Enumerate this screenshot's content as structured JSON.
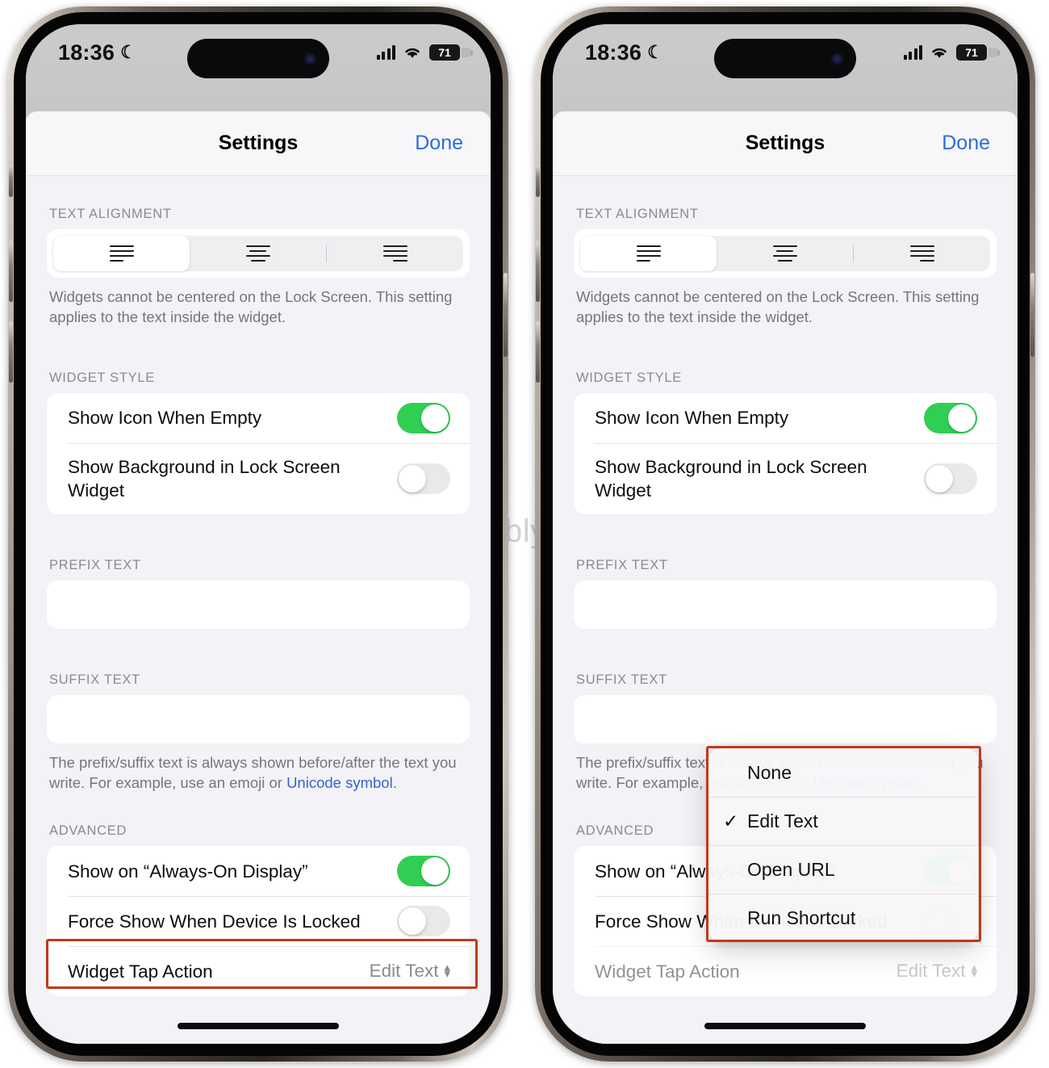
{
  "statusbar": {
    "time": "18:36",
    "dnd_icon": "☾",
    "battery_percent": "71",
    "signal_icon": "cellular-bars-icon",
    "wifi_icon": "wifi-icon"
  },
  "navbar": {
    "title": "Settings",
    "done_label": "Done"
  },
  "sections": {
    "text_alignment": {
      "header": "TEXT ALIGNMENT",
      "options": [
        "align-left",
        "align-center",
        "align-right"
      ],
      "selected_index": 0,
      "footer": "Widgets cannot be centered on the Lock Screen. This setting applies to the text inside the widget."
    },
    "widget_style": {
      "header": "WIDGET STYLE",
      "rows": [
        {
          "label": "Show Icon When Empty",
          "toggle": "on"
        },
        {
          "label": "Show Background in Lock Screen Widget",
          "toggle": "off"
        }
      ]
    },
    "prefix_text": {
      "header": "PREFIX TEXT",
      "value": "",
      "placeholder": ""
    },
    "suffix_text": {
      "header": "SUFFIX TEXT",
      "value": "",
      "placeholder": ""
    },
    "prefix_suffix_footer": {
      "text_before": "The prefix/suffix text is always shown before/after the text you write. For example, use an emoji or ",
      "link_text": "Unicode symbol",
      "text_after": "."
    },
    "advanced": {
      "header": "ADVANCED",
      "rows": [
        {
          "label": "Show on “Always-On Display”",
          "toggle": "on"
        },
        {
          "label": "Force Show When Device Is Locked",
          "toggle": "off"
        },
        {
          "label": "Widget Tap Action",
          "value": "Edit Text",
          "chevron": "chevron-up-down-icon"
        }
      ]
    }
  },
  "menu": {
    "items": [
      {
        "label": "None",
        "checked": false
      },
      {
        "label": "Edit Text",
        "checked": true
      },
      {
        "label": "Open URL",
        "checked": false
      },
      {
        "label": "Run Shortcut",
        "checked": false
      }
    ],
    "check_glyph": "✓"
  },
  "watermark": "Yablyk",
  "colors": {
    "accent_blue": "#2d6cdf",
    "toggle_on_green": "#30cf53",
    "toggle_off_gray": "#e9e9eb",
    "highlight_red": "#c0391b",
    "link_blue": "#3a62c9",
    "page_background": "#f2f2f7"
  }
}
